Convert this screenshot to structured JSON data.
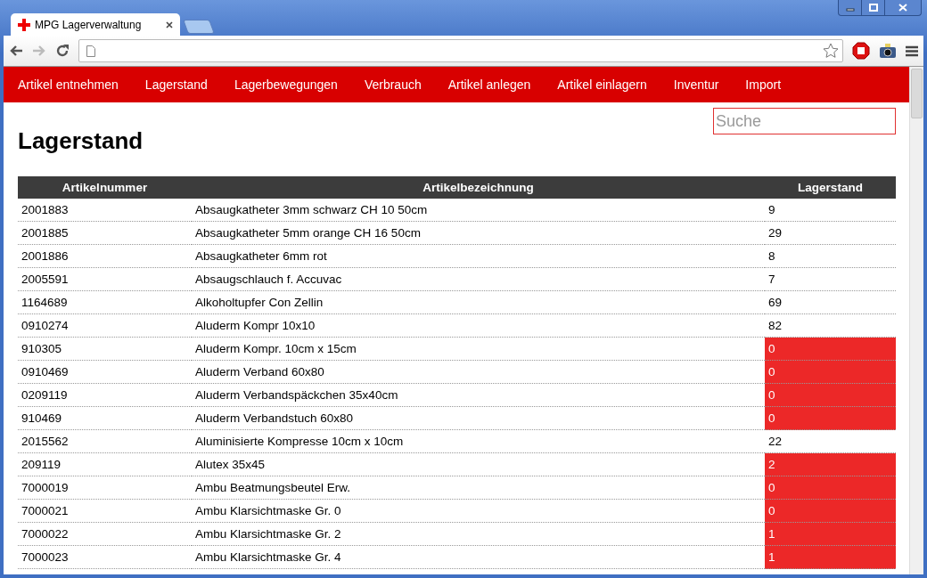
{
  "browser": {
    "tab_title": "MPG Lagerverwaltung"
  },
  "nav": {
    "items": [
      {
        "label": "Artikel entnehmen"
      },
      {
        "label": "Lagerstand"
      },
      {
        "label": "Lagerbewegungen"
      },
      {
        "label": "Verbrauch"
      },
      {
        "label": "Artikel anlegen"
      },
      {
        "label": "Artikel einlagern"
      },
      {
        "label": "Inventur"
      },
      {
        "label": "Import"
      }
    ]
  },
  "search": {
    "placeholder": "Suche"
  },
  "page_title": "Lagerstand",
  "table": {
    "columns": [
      "Artikelnummer",
      "Artikelbezeichnung",
      "Lagerstand"
    ],
    "rows": [
      {
        "number": "2001883",
        "name": "Absaugkatheter 3mm schwarz CH 10 50cm",
        "stock": "9",
        "low": false
      },
      {
        "number": "2001885",
        "name": "Absaugkatheter 5mm orange CH 16 50cm",
        "stock": "29",
        "low": false
      },
      {
        "number": "2001886",
        "name": "Absaugkatheter 6mm rot",
        "stock": "8",
        "low": false
      },
      {
        "number": "2005591",
        "name": "Absaugschlauch f. Accuvac",
        "stock": "7",
        "low": false
      },
      {
        "number": "1164689",
        "name": "Alkoholtupfer Con Zellin",
        "stock": "69",
        "low": false
      },
      {
        "number": "0910274",
        "name": "Aluderm Kompr 10x10",
        "stock": "82",
        "low": false
      },
      {
        "number": "910305",
        "name": "Aluderm Kompr. 10cm x 15cm",
        "stock": "0",
        "low": true
      },
      {
        "number": "0910469",
        "name": "Aluderm Verband 60x80",
        "stock": "0",
        "low": true
      },
      {
        "number": "0209119",
        "name": "Aluderm Verbandspäckchen 35x40cm",
        "stock": "0",
        "low": true
      },
      {
        "number": "910469",
        "name": "Aluderm Verbandstuch 60x80",
        "stock": "0",
        "low": true
      },
      {
        "number": "2015562",
        "name": "Aluminisierte Kompresse 10cm x 10cm",
        "stock": "22",
        "low": false
      },
      {
        "number": "209119",
        "name": "Alutex 35x45",
        "stock": "2",
        "low": true
      },
      {
        "number": "7000019",
        "name": "Ambu Beatmungsbeutel Erw.",
        "stock": "0",
        "low": true
      },
      {
        "number": "7000021",
        "name": "Ambu Klarsichtmaske Gr. 0",
        "stock": "0",
        "low": true
      },
      {
        "number": "7000022",
        "name": "Ambu Klarsichtmaske Gr. 2",
        "stock": "1",
        "low": true
      },
      {
        "number": "7000023",
        "name": "Ambu Klarsichtmaske Gr. 4",
        "stock": "1",
        "low": true
      }
    ]
  }
}
